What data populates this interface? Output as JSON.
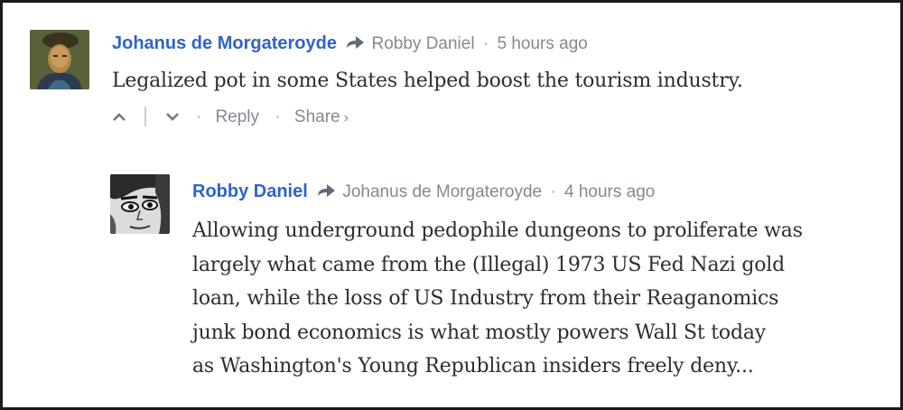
{
  "comments": [
    {
      "author": "Johanus de Morgateroyde",
      "reply_to": "Robby Daniel",
      "separator": "·",
      "time": "5 hours ago",
      "text": "Legalized pot in some States helped boost the tourism industry.",
      "actions": {
        "reply": "Reply",
        "share": "Share",
        "share_chevron": "›",
        "upvote_icon": "chevron-up-icon",
        "downvote_icon": "chevron-down-icon"
      },
      "avatar_icon": "painted-portrait-avatar"
    },
    {
      "author": "Robby Daniel",
      "reply_to": "Johanus de Morgateroyde",
      "separator": "·",
      "time": "4 hours ago",
      "text_lines": [
        "Allowing underground pedophile dungeons to proliferate was",
        "largely what came from the (Illegal) 1973 US Fed Nazi gold",
        "loan, while the loss of US Industry from their Reaganomics",
        "junk bond economics is what mostly powers Wall St today",
        "as Washington's Young Republican insiders freely deny..."
      ],
      "avatar_icon": "sketch-face-avatar"
    }
  ],
  "colors": {
    "author": "#2e64c8",
    "meta": "#7f8a93",
    "body": "#2a2e33",
    "border": "#1a1a1a"
  }
}
